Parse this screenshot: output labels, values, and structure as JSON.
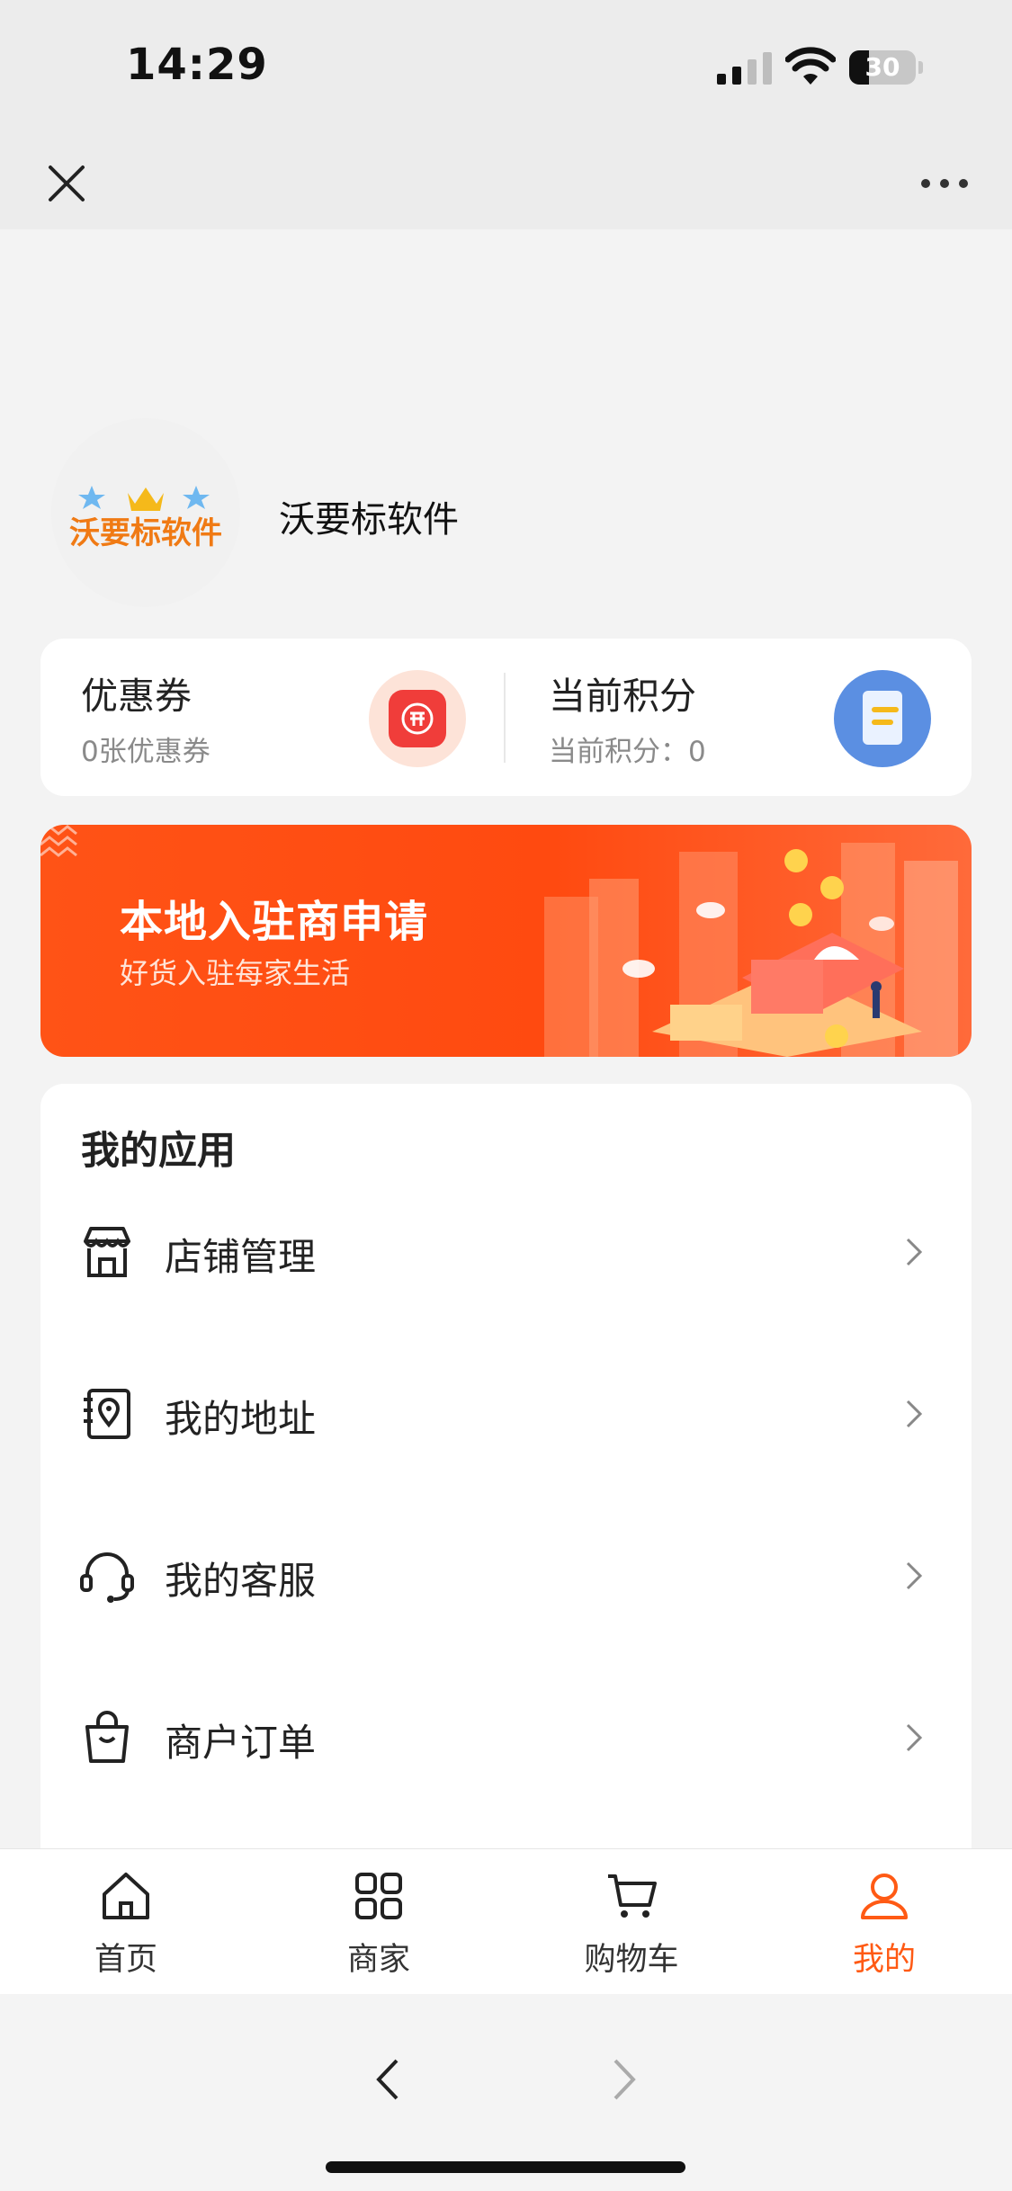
{
  "status_bar": {
    "time": "14:29",
    "battery": "30",
    "battery_level": 0.3
  },
  "navbar": {
    "close_icon": "close-icon",
    "more_icon": "more-icon"
  },
  "profile": {
    "name": "沃要标软件",
    "logo_text": "沃要标软件"
  },
  "points_card": {
    "coupon": {
      "title": "优惠券",
      "subtitle": "0张优惠券",
      "icon": "coupon-icon"
    },
    "points": {
      "title": "当前积分",
      "subtitle": "当前积分：0",
      "icon": "points-icon"
    }
  },
  "banner": {
    "title": "本地入驻商申请",
    "subtitle": "好货入驻每家生活"
  },
  "apps": {
    "title": "我的应用",
    "items": [
      {
        "label": "店铺管理",
        "icon": "store-icon"
      },
      {
        "label": "我的地址",
        "icon": "address-book-icon"
      },
      {
        "label": "我的客服",
        "icon": "headset-icon"
      },
      {
        "label": "商户订单",
        "icon": "shopping-bag-icon"
      }
    ]
  },
  "tabbar": {
    "items": [
      {
        "label": "首页",
        "icon": "home-icon"
      },
      {
        "label": "商家",
        "icon": "grid-icon"
      },
      {
        "label": "购物车",
        "icon": "cart-icon"
      },
      {
        "label": "我的",
        "icon": "user-icon",
        "active": true
      }
    ]
  },
  "colors": {
    "accent": "#ff5a14",
    "banner": "#ff4f12",
    "background": "#f3f3f3"
  }
}
